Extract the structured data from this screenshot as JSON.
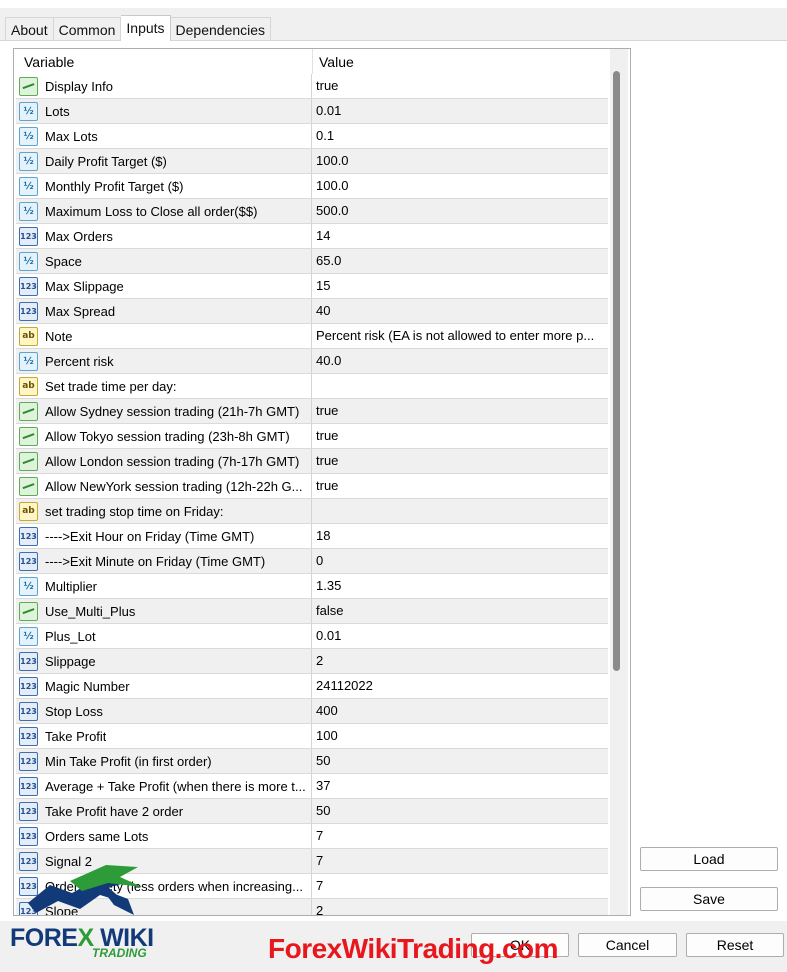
{
  "tabs": [
    "About",
    "Common",
    "Inputs",
    "Dependencies"
  ],
  "columns": {
    "variable": "Variable",
    "value": "Value"
  },
  "rows": [
    {
      "type": "bool",
      "name": "Display Info",
      "value": "true"
    },
    {
      "type": "dbl",
      "name": "Lots",
      "value": "0.01"
    },
    {
      "type": "dbl",
      "name": "Max Lots",
      "value": "0.1"
    },
    {
      "type": "dbl",
      "name": "Daily Profit Target ($)",
      "value": "100.0"
    },
    {
      "type": "dbl",
      "name": "Monthly Profit Target ($)",
      "value": "100.0"
    },
    {
      "type": "dbl",
      "name": "Maximum Loss to Close all order($$)",
      "value": "500.0"
    },
    {
      "type": "int",
      "name": "Max Orders",
      "value": "14"
    },
    {
      "type": "dbl",
      "name": "Space",
      "value": "65.0"
    },
    {
      "type": "int",
      "name": "Max Slippage",
      "value": "15"
    },
    {
      "type": "int",
      "name": "Max Spread",
      "value": "40"
    },
    {
      "type": "str",
      "name": "Note",
      "value": "Percent risk (EA is not allowed to enter more p..."
    },
    {
      "type": "dbl",
      "name": "Percent risk",
      "value": "40.0"
    },
    {
      "type": "str",
      "name": "Set trade time per day:",
      "value": ""
    },
    {
      "type": "bool",
      "name": "Allow Sydney session trading (21h-7h GMT)",
      "value": "true"
    },
    {
      "type": "bool",
      "name": "Allow Tokyo session trading (23h-8h GMT)",
      "value": "true"
    },
    {
      "type": "bool",
      "name": "Allow London session trading (7h-17h GMT)",
      "value": "true"
    },
    {
      "type": "bool",
      "name": "Allow NewYork session trading (12h-22h G...",
      "value": "true"
    },
    {
      "type": "str",
      "name": "set trading stop time on Friday:",
      "value": ""
    },
    {
      "type": "int",
      "name": "---->Exit Hour on Friday (Time GMT)",
      "value": "18"
    },
    {
      "type": "int",
      "name": "---->Exit Minute on Friday (Time GMT)",
      "value": "0"
    },
    {
      "type": "dbl",
      "name": "Multiplier",
      "value": "1.35"
    },
    {
      "type": "bool",
      "name": "Use_Multi_Plus",
      "value": "false"
    },
    {
      "type": "dbl",
      "name": "Plus_Lot",
      "value": "0.01"
    },
    {
      "type": "int",
      "name": "Slippage",
      "value": "2"
    },
    {
      "type": "int",
      "name": "Magic Number",
      "value": "24112022"
    },
    {
      "type": "int",
      "name": "Stop Loss",
      "value": "400"
    },
    {
      "type": "int",
      "name": "Take Profit",
      "value": "100"
    },
    {
      "type": "int",
      "name": "Min Take Profit (in first order)",
      "value": "50"
    },
    {
      "type": "int",
      "name": "Average + Take Profit (when there is more t...",
      "value": "37"
    },
    {
      "type": "int",
      "name": "Take Profit have 2 order",
      "value": "50"
    },
    {
      "type": "int",
      "name": "Orders same Lots",
      "value": "7"
    },
    {
      "type": "int",
      "name": "Signal 2",
      "value": "7"
    },
    {
      "type": "int",
      "name": "Orders safety (less orders when increasing...",
      "value": "7"
    },
    {
      "type": "int",
      "name": "Slope",
      "value": "2"
    }
  ],
  "icon_glyphs": {
    "bool": "",
    "dbl": "½",
    "int": "123",
    "str": "ab"
  },
  "buttons": {
    "load": "Load",
    "save": "Save",
    "ok": "OK",
    "cancel": "Cancel",
    "reset": "Reset"
  },
  "branding": {
    "logo_main": "FORE",
    "logo_x": "X",
    "logo_wiki": " WIKI",
    "logo_sub": "TRADING",
    "watermark": "ForexWikiTrading.com"
  },
  "colors": {
    "bool_icon": "#2d8c2d",
    "double_icon": "#1d6ea8",
    "int_icon": "#23508f",
    "string_icon": "#c9a82c",
    "watermark": "#e8161d"
  }
}
